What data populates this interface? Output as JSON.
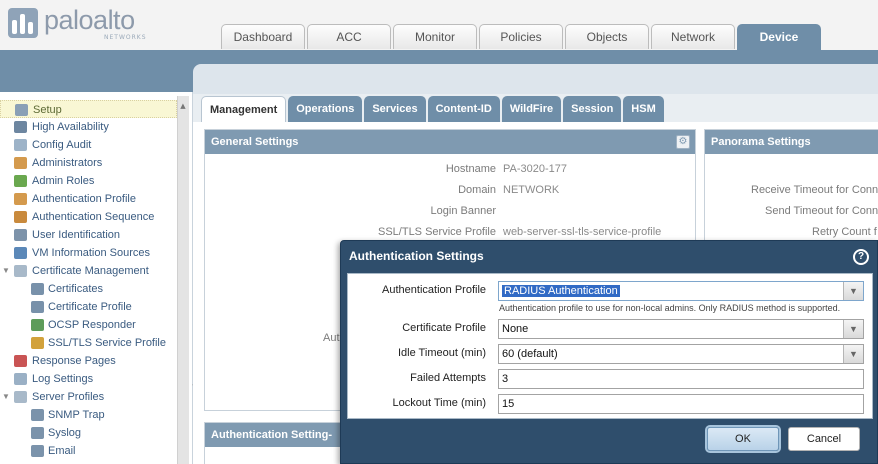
{
  "brand": {
    "name": "paloalto",
    "sub": "NETWORKS"
  },
  "main_tabs": [
    {
      "label": "Dashboard"
    },
    {
      "label": "ACC"
    },
    {
      "label": "Monitor"
    },
    {
      "label": "Policies"
    },
    {
      "label": "Objects"
    },
    {
      "label": "Network"
    },
    {
      "label": "Device"
    }
  ],
  "sidebar": {
    "items": [
      {
        "label": "Setup",
        "icon": "setup-icon",
        "color": "#8aa0b6"
      },
      {
        "label": "High Availability",
        "icon": "ha-icon",
        "color": "#6d86a0"
      },
      {
        "label": "Config Audit",
        "icon": "audit-icon",
        "color": "#9db3c8"
      },
      {
        "label": "Administrators",
        "icon": "admin-icon",
        "color": "#d49a4d"
      },
      {
        "label": "Admin Roles",
        "icon": "admin-role-icon",
        "color": "#6aa84f"
      },
      {
        "label": "Authentication Profile",
        "icon": "auth-profile-icon",
        "color": "#d49a4d"
      },
      {
        "label": "Authentication Sequence",
        "icon": "auth-sequence-icon",
        "color": "#c98a3d"
      },
      {
        "label": "User Identification",
        "icon": "user-id-icon",
        "color": "#7d93aa"
      },
      {
        "label": "VM Information Sources",
        "icon": "vm-icon",
        "color": "#5b88b8"
      },
      {
        "label": "Certificate Management",
        "icon": "cert-mgmt-icon",
        "color": "#a8b9c9"
      },
      {
        "label": "Certificates",
        "icon": "certificate-icon",
        "color": "#7891aa"
      },
      {
        "label": "Certificate Profile",
        "icon": "cert-profile-icon",
        "color": "#7891aa"
      },
      {
        "label": "OCSP Responder",
        "icon": "ocsp-icon",
        "color": "#5d9c5a"
      },
      {
        "label": "SSL/TLS Service Profile",
        "icon": "lock-icon",
        "color": "#d2a23c"
      },
      {
        "label": "Response Pages",
        "icon": "response-pages-icon",
        "color": "#c95454"
      },
      {
        "label": "Log Settings",
        "icon": "log-settings-icon",
        "color": "#9ab0c5"
      },
      {
        "label": "Server Profiles",
        "icon": "server-profiles-icon",
        "color": "#a8b9c9"
      },
      {
        "label": "SNMP Trap",
        "icon": "snmp-icon",
        "color": "#7b93ab"
      },
      {
        "label": "Syslog",
        "icon": "syslog-icon",
        "color": "#7b93ab"
      },
      {
        "label": "Email",
        "icon": "email-icon",
        "color": "#7b93ab"
      }
    ]
  },
  "content_tabs": [
    {
      "label": "Management"
    },
    {
      "label": "Operations"
    },
    {
      "label": "Services"
    },
    {
      "label": "Content-ID"
    },
    {
      "label": "WildFire"
    },
    {
      "label": "Session"
    },
    {
      "label": "HSM"
    }
  ],
  "general_settings": {
    "title": "General Settings",
    "rows": [
      {
        "label": "Hostname",
        "value": "PA-3020-177"
      },
      {
        "label": "Domain",
        "value": "NETWORK"
      },
      {
        "label": "Login Banner",
        "value": ""
      },
      {
        "label": "SSL/TLS Service Profile",
        "value": "web-server-ssl-tls-service-profile"
      }
    ],
    "partial_label": "Aut"
  },
  "panorama_settings": {
    "title": "Panorama Settings",
    "rows": [
      {
        "label": "Receive Timeout for Conn"
      },
      {
        "label": "Send Timeout for Conn"
      },
      {
        "label": "Retry Count f"
      }
    ]
  },
  "auth_settings_panel": {
    "title": "Authentication Setting-"
  },
  "dialog": {
    "title": "Authentication Settings",
    "help": "?",
    "fields": {
      "auth_profile": {
        "label": "Authentication Profile",
        "value": "RADIUS Authentication",
        "hint": "Authentication profile to use for non-local admins. Only RADIUS method is supported."
      },
      "cert_profile": {
        "label": "Certificate Profile",
        "value": "None"
      },
      "idle_timeout": {
        "label": "Idle Timeout (min)",
        "value": "60 (default)"
      },
      "failed_attempts": {
        "label": "Failed Attempts",
        "value": "3"
      },
      "lockout_time": {
        "label": "Lockout Time (min)",
        "value": "15"
      }
    },
    "ok_label": "OK",
    "cancel_label": "Cancel"
  }
}
